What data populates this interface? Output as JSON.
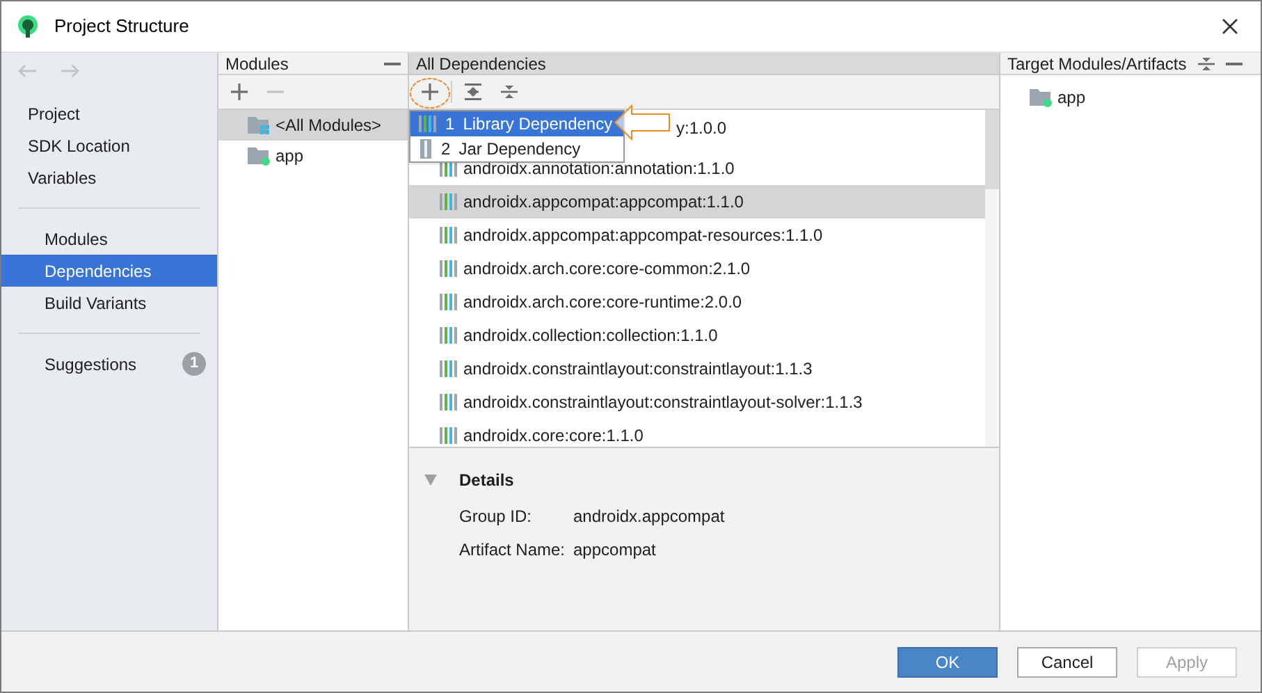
{
  "window": {
    "title": "Project Structure"
  },
  "sidebar": {
    "groups": [
      {
        "items": [
          {
            "label": "Project",
            "selected": false
          },
          {
            "label": "SDK Location",
            "selected": false
          },
          {
            "label": "Variables",
            "selected": false
          }
        ]
      },
      {
        "items": [
          {
            "label": "Modules",
            "selected": false
          },
          {
            "label": "Dependencies",
            "selected": true
          },
          {
            "label": "Build Variants",
            "selected": false
          }
        ]
      },
      {
        "items": [
          {
            "label": "Suggestions",
            "selected": false,
            "badge": "1"
          }
        ]
      }
    ]
  },
  "modules": {
    "title": "Modules",
    "items": [
      {
        "label": "<All Modules>",
        "kind": "all",
        "selected": true
      },
      {
        "label": "app",
        "kind": "module",
        "selected": false
      }
    ]
  },
  "dependencies": {
    "title": "All Dependencies",
    "rows": [
      {
        "label": "y:1.0.0",
        "selected": false
      },
      {
        "label": "androidx.annotation:annotation:1.1.0",
        "selected": false
      },
      {
        "label": "androidx.appcompat:appcompat:1.1.0",
        "selected": true
      },
      {
        "label": "androidx.appcompat:appcompat-resources:1.1.0",
        "selected": false
      },
      {
        "label": "androidx.arch.core:core-common:2.1.0",
        "selected": false
      },
      {
        "label": "androidx.arch.core:core-runtime:2.0.0",
        "selected": false
      },
      {
        "label": "androidx.collection:collection:1.1.0",
        "selected": false
      },
      {
        "label": "androidx.constraintlayout:constraintlayout:1.1.3",
        "selected": false
      },
      {
        "label": "androidx.constraintlayout:constraintlayout-solver:1.1.3",
        "selected": false
      },
      {
        "label": "androidx.core:core:1.1.0",
        "selected": false
      }
    ],
    "menu": [
      {
        "number": "1",
        "label": "Library Dependency",
        "kind": "library",
        "selected": true
      },
      {
        "number": "2",
        "label": "Jar Dependency",
        "kind": "jar",
        "selected": false
      }
    ],
    "details": {
      "title": "Details",
      "expanded": true,
      "fields": [
        {
          "label": "Group ID:",
          "value": "androidx.appcompat"
        },
        {
          "label": "Artifact Name:",
          "value": "appcompat"
        }
      ]
    }
  },
  "targets": {
    "title": "Target Modules/Artifacts",
    "items": [
      {
        "label": "app"
      }
    ]
  },
  "buttons": [
    {
      "label": "OK",
      "kind": "primary",
      "disabled": false
    },
    {
      "label": "Cancel",
      "kind": "normal",
      "disabled": false
    },
    {
      "label": "Apply",
      "kind": "normal",
      "disabled": true
    }
  ]
}
